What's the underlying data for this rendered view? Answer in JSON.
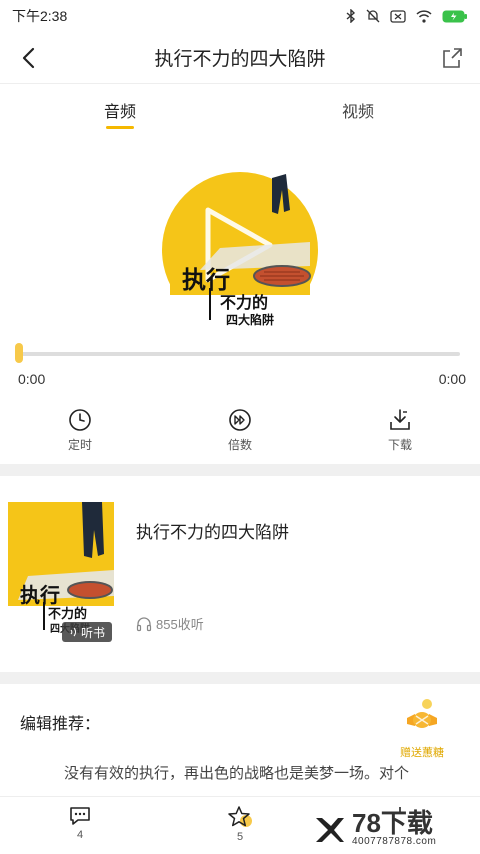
{
  "status_bar": {
    "time": "下午2:38"
  },
  "header": {
    "title": "执行不力的四大陷阱"
  },
  "tabs": [
    {
      "label": "音频",
      "active": true
    },
    {
      "label": "视频",
      "active": false
    }
  ],
  "cover": {
    "title_line1": "执行",
    "title_line2": "不力的",
    "title_line3": "四大陷阱"
  },
  "player": {
    "elapsed": "0:00",
    "duration": "0:00",
    "progress": 0
  },
  "controls": [
    {
      "label": "定时",
      "icon": "clock-icon"
    },
    {
      "label": "倍数",
      "icon": "speed-icon"
    },
    {
      "label": "下载",
      "icon": "download-icon"
    }
  ],
  "album": {
    "title": "执行不力的四大陷阱",
    "plays": "855收听",
    "badge": "听书"
  },
  "editor": {
    "heading": "编辑推荐：",
    "text": "没有有效的执行，再出色的战略也是美梦一场。对个",
    "gift_label": "赠送蕙糖"
  },
  "bottom_bar": {
    "comment_count": "4",
    "star_count": "5"
  },
  "watermark": {
    "main": "78下载",
    "sub": "4007787878.com"
  },
  "colors": {
    "accent": "#f5b800",
    "cover_yellow": "#f5c518"
  }
}
